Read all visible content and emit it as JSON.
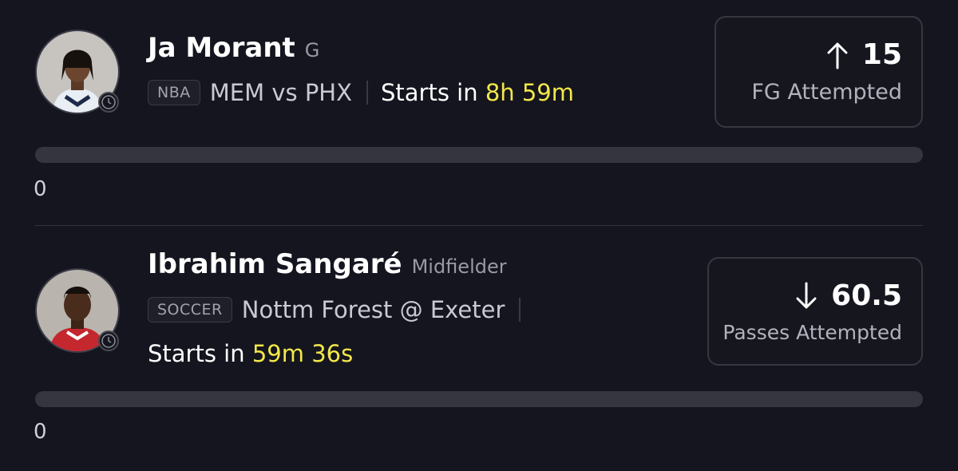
{
  "players": [
    {
      "name": "Ja Morant",
      "position": "G",
      "league": "NBA",
      "matchup": "MEM vs PHX",
      "starts_prefix": "Starts in",
      "countdown": "8h 59m",
      "stat": {
        "direction": "up",
        "direction_icon": "arrow-up-icon",
        "value": "15",
        "label": "FG Attempted"
      },
      "progress": {
        "current": "0",
        "fraction": 0
      },
      "jersey_color": "#e9eef5"
    },
    {
      "name": "Ibrahim Sangaré",
      "position": "Midfielder",
      "league": "SOCCER",
      "matchup": "Nottm Forest @ Exeter",
      "starts_prefix": "Starts in",
      "countdown": "59m 36s",
      "stat": {
        "direction": "down",
        "direction_icon": "arrow-down-icon",
        "value": "60.5",
        "label": "Passes Attempted"
      },
      "progress": {
        "current": "0",
        "fraction": 0
      },
      "jersey_color": "#c4272e"
    }
  ],
  "colors": {
    "background": "#15151f",
    "accent_yellow": "#f2e84a",
    "track": "#35353f"
  }
}
